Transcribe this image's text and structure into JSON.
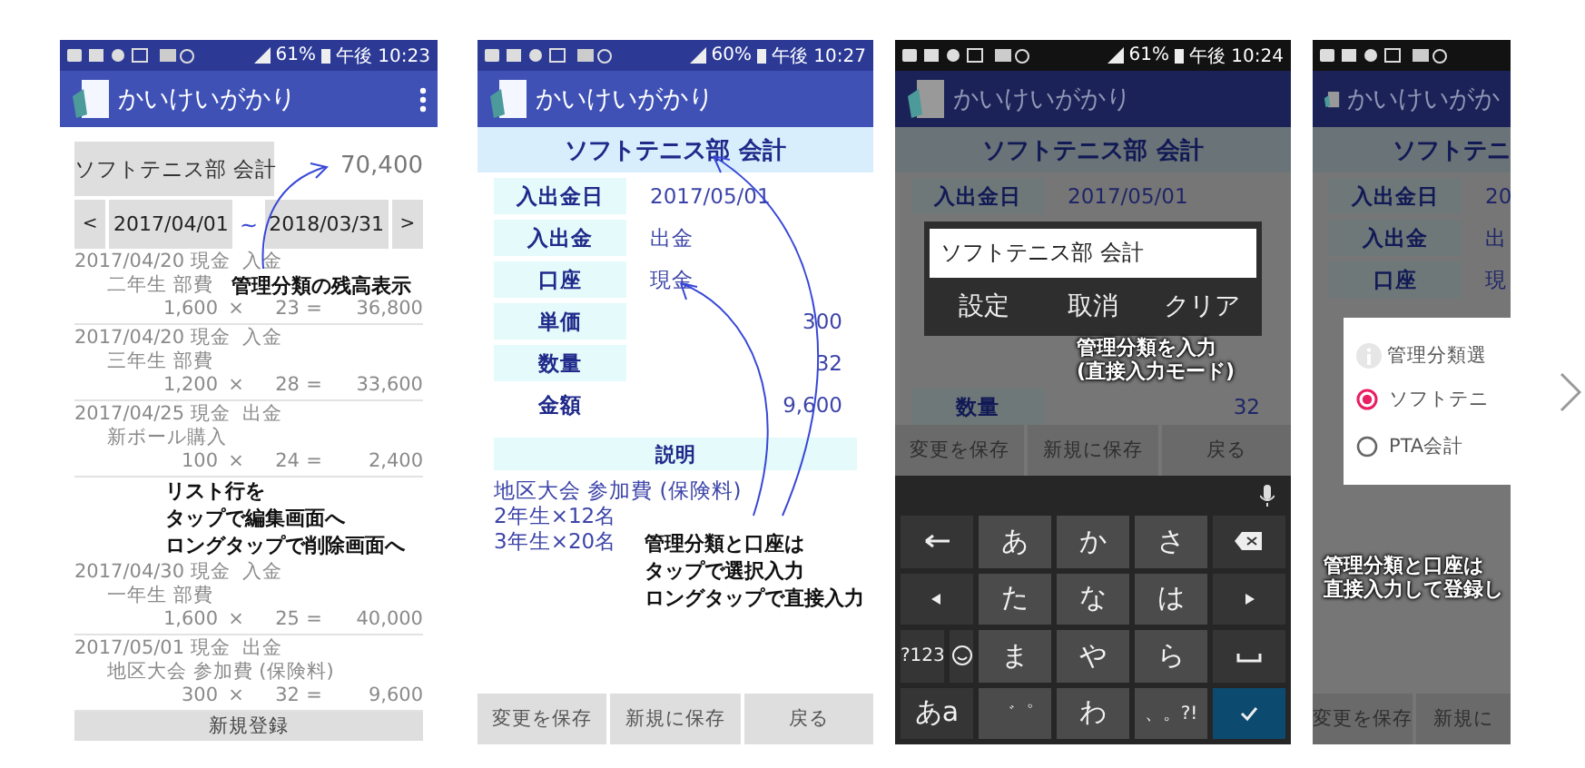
{
  "phones": [
    {
      "kind": "list",
      "dimmed": false,
      "status_bar": {
        "battery": "61%",
        "time": "午後 10:23"
      },
      "app_title": "かいけいがかり",
      "category_button": "ソフトテニス部 会計",
      "balance": "70,400",
      "date_range": {
        "prev": "<",
        "start": "2017/04/01",
        "separator": "~",
        "end": "2018/03/31",
        "next": ">"
      },
      "entries": [
        {
          "header": "2017/04/20 現金  入金",
          "description": "二年生 部費",
          "price": "1,600",
          "times": "×",
          "quantity": "23",
          "equals": "=",
          "amount": "36,800"
        },
        {
          "header": "2017/04/20 現金  入金",
          "description": "三年生 部費",
          "price": "1,200",
          "times": "×",
          "quantity": "28",
          "equals": "=",
          "amount": "33,600"
        },
        {
          "header": "2017/04/25 現金  出金",
          "description": "新ボール購入",
          "price": "100",
          "times": "×",
          "quantity": "24",
          "equals": "=",
          "amount": "2,400"
        },
        {
          "header": "2017/04/30 現金  入金",
          "description": "一年生 部費",
          "price": "1,600",
          "times": "×",
          "quantity": "25",
          "equals": "=",
          "amount": "40,000"
        },
        {
          "header": "2017/05/01 現金  出金",
          "description": "地区大会 参加費 (保険料)",
          "price": "300",
          "times": "×",
          "quantity": "32",
          "equals": "=",
          "amount": "9,600"
        }
      ],
      "new_button": "新規登録",
      "notes": [
        {
          "lines": [
            "管理分類の残高表示"
          ]
        },
        {
          "lines": [
            "リスト行を",
            "タップで編集画面へ",
            "ロングタップで削除画面へ"
          ]
        }
      ]
    },
    {
      "kind": "edit",
      "dimmed": false,
      "status_bar": {
        "battery": "60%",
        "time": "午後 10:27"
      },
      "app_title": "かいけいがかり",
      "header": "ソフトテニス部 会計",
      "fields": [
        {
          "label": "入出金日",
          "value": "2017/05/01",
          "right_aligned": false,
          "shaded": true
        },
        {
          "label": "入出金",
          "value": "出金",
          "right_aligned": false,
          "shaded": true
        },
        {
          "label": "口座",
          "value": "現金",
          "right_aligned": false,
          "shaded": true
        },
        {
          "label": "単価",
          "value": "300",
          "right_aligned": true,
          "shaded": true
        },
        {
          "label": "数量",
          "value": "32",
          "right_aligned": true,
          "shaded": true
        },
        {
          "label": "金額",
          "value": "9,600",
          "right_aligned": true,
          "shaded": false
        }
      ],
      "description_label": "説明",
      "description_lines": [
        "地区大会 参加費 (保険料)",
        "2年生×12名",
        "3年生×20名"
      ],
      "buttons": [
        "変更を保存",
        "新規に保存",
        "戻る"
      ],
      "notes": [
        {
          "lines": [
            "管理分類と口座は",
            "タップで選択入力",
            "ロングタップで直接入力"
          ]
        }
      ]
    },
    {
      "kind": "input_dialog",
      "dimmed": true,
      "status_bar": {
        "battery": "61%",
        "time": "午後 10:24"
      },
      "app_title": "かいけいがかり",
      "header": "ソフトテニス部 会計",
      "fields": [
        {
          "label": "入出金日",
          "value": "2017/05/01",
          "right_aligned": false,
          "shaded": true
        },
        {
          "label": "数量",
          "value": "32",
          "right_aligned": true,
          "shaded": true
        }
      ],
      "dialog": {
        "value": "ソフトテニス部 会計",
        "buttons": [
          "設定",
          "取消",
          "クリア"
        ]
      },
      "buttons": [
        "変更を保存",
        "新規に保存",
        "戻る"
      ],
      "keyboard": {
        "kana": [
          "あ",
          "か",
          "さ",
          "た",
          "な",
          "は",
          "ま",
          "や",
          "ら",
          "わ"
        ],
        "symbols_key": "?123",
        "mode_key": "あa",
        "dakuten_key": "゛゜",
        "punctuation_key": "、。?!"
      },
      "notes": [
        {
          "lines": [
            "管理分類を入力",
            "(直接入力モード)"
          ]
        }
      ]
    },
    {
      "kind": "select_dialog",
      "dimmed": true,
      "app_title": "かいけいがか",
      "header": "ソフトテニ",
      "fields": [
        {
          "label": "入出金日",
          "value": "20",
          "right_aligned": false,
          "shaded": true
        },
        {
          "label": "入出金",
          "value": "出",
          "right_aligned": false,
          "shaded": true
        },
        {
          "label": "口座",
          "value": "現",
          "right_aligned": false,
          "shaded": true
        }
      ],
      "dialog": {
        "title": "管理分類選",
        "options": [
          {
            "label": "ソフトテニ",
            "selected": true
          },
          {
            "label": "PTA会計",
            "selected": false
          }
        ]
      },
      "notes": [
        {
          "lines": [
            "管理分類と口座は",
            "直接入力して登録し"
          ]
        }
      ],
      "buttons": [
        "変更を保存",
        "新規に"
      ]
    }
  ]
}
